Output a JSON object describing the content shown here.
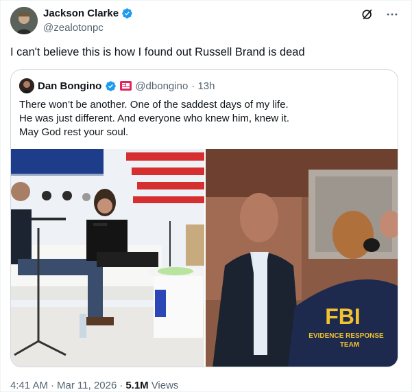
{
  "author": {
    "name": "Jackson Clarke",
    "handle": "@zealotonpc"
  },
  "tweet": {
    "text": "I can't believe this is how I found out Russell Brand is dead"
  },
  "quoted": {
    "name": "Dan Bongino",
    "handle": "@dbongino",
    "time": "· 13h",
    "lines": [
      "There won’t be another. One of the saddest days of my life.",
      "He was just different. And everyone who knew him, knew it.",
      "May God rest your soul."
    ]
  },
  "photo_right": {
    "vest_line1": "FBI",
    "vest_line2": "EVIDENCE RESPONSE",
    "vest_line3": "TEAM"
  },
  "meta": {
    "time": "4:41 AM",
    "separator": "·",
    "date": "Mar 11, 2026",
    "separator2": "·",
    "views_count": "5.1M",
    "views_label": "Views"
  },
  "colors": {
    "verified": "#1d9bf0",
    "flag": "#e0245e",
    "text_secondary": "#536471"
  }
}
